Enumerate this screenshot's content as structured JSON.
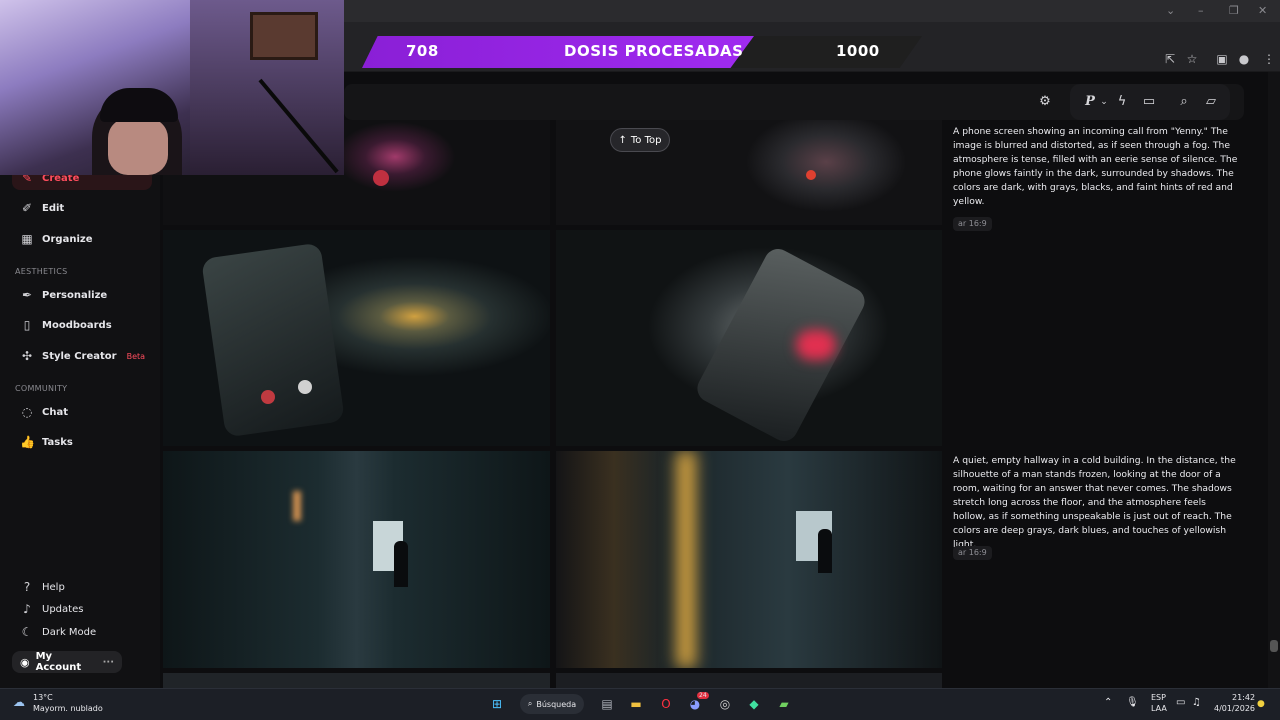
{
  "banner": {
    "left_value": "708",
    "title": "DOSIS PROCESADAS",
    "right_value": "1000"
  },
  "sidebar": {
    "top_items": [
      {
        "label": "Create",
        "icon": "create-icon"
      },
      {
        "label": "Edit",
        "icon": "edit-icon"
      },
      {
        "label": "Organize",
        "icon": "organize-icon"
      }
    ],
    "aesthetics_label": "AESTHETICS",
    "aesthetics_items": [
      {
        "label": "Personalize",
        "icon": "personalize-icon"
      },
      {
        "label": "Moodboards",
        "icon": "moodboards-icon"
      },
      {
        "label": "Style Creator",
        "icon": "style-creator-icon",
        "badge": "Beta"
      }
    ],
    "community_label": "COMMUNITY",
    "community_items": [
      {
        "label": "Chat",
        "icon": "chat-icon"
      },
      {
        "label": "Tasks",
        "icon": "tasks-icon"
      }
    ],
    "bottom_items": [
      {
        "label": "Help",
        "icon": "help-icon"
      },
      {
        "label": "Updates",
        "icon": "bell-icon"
      },
      {
        "label": "Dark Mode",
        "icon": "moon-icon"
      }
    ],
    "account": {
      "label": "My Account",
      "more": "···"
    }
  },
  "toolbar": {
    "profile_letter": "P"
  },
  "main": {
    "to_top_label": "To Top",
    "prompts": [
      {
        "text": "A phone screen showing an incoming call from \"Yenny.\" The image is blurred and distorted, as if seen through a fog. The atmosphere is tense, filled with an eerie sense of silence. The phone glows faintly in the dark, surrounded by shadows. The colors are dark, with grays, blacks, and faint hints of red and yellow.",
        "ar": "ar 16:9"
      },
      {
        "text": "A quiet, empty hallway in a cold building. In the distance, the silhouette of a man stands frozen, looking at the door of a room, waiting for an answer that never comes. The shadows stretch long across the floor, and the atmosphere feels hollow, as if something unspeakable is just out of reach. The colors are deep grays, dark blues, and touches of yellowish light.",
        "ar": "ar 16:9"
      }
    ]
  },
  "taskbar": {
    "weather_temp": "13°C",
    "weather_desc": "Mayorm. nublado",
    "search_label": "Búsqueda",
    "lang_top": "ESP",
    "lang_bottom": "LAA",
    "time": "21:42",
    "date": "4/01/2026",
    "discord_badge": "24"
  },
  "colors": {
    "accent": "#ff4d5e",
    "banner_purple": "#9b27e8",
    "background": "#0d0d0f"
  }
}
